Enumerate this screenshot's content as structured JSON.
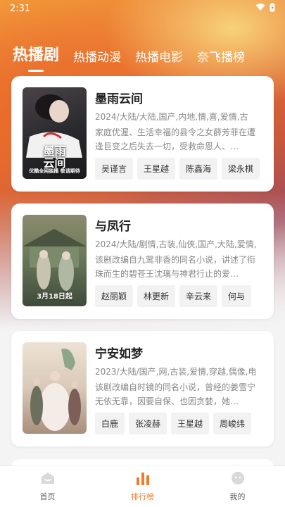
{
  "status": {
    "time": "2:31"
  },
  "tabs": [
    {
      "label": "热播剧",
      "active": true
    },
    {
      "label": "热播动漫",
      "active": false
    },
    {
      "label": "热播电影",
      "active": false
    },
    {
      "label": "奈飞播榜",
      "active": false
    }
  ],
  "items": [
    {
      "title": "墨雨云间",
      "meta": "2024/大陆/大陆,国产,内地,情,喜,爱情,古",
      "desc": "家庭优渥、生活幸福的县令之女薛芳菲在遭逢巨变之后失去一切，受救命恩人、…",
      "actors": [
        "吴谨言",
        "王星越",
        "陈鑫海",
        "梁永棋"
      ],
      "poster_title": "墨雨\n云间",
      "poster_caption": "优酷全网独播 敬请期待",
      "poster_colors": [
        "#2b2b2e",
        "#5a5257"
      ]
    },
    {
      "title": "与凤行",
      "meta": "2024/大陆/剧情,古装,仙侠,国产,大陆,爱情,",
      "desc": "该剧改编自九鹭非香的同名小说，讲述了衔珠而生的碧苍王沈璃与神君行止的爱…",
      "actors": [
        "赵丽颖",
        "林更新",
        "辛云来",
        "何与"
      ],
      "poster_caption": "3月18日起",
      "poster_colors": [
        "#6b7a5a",
        "#a39a78"
      ]
    },
    {
      "title": "宁安如梦",
      "meta": "2023/大陆/国产,网,古装,爱情,穿越,偶像,电",
      "desc": "该剧改编自时镜的同名小说，曾经的姜雪宁无依无靠，因要自保、也因贪婪，她…",
      "actors": [
        "白鹿",
        "张凌赫",
        "王星越",
        "周峻纬"
      ],
      "poster_colors": [
        "#d9c9b8",
        "#b7a08f"
      ]
    }
  ],
  "nav": [
    {
      "label": "首页",
      "icon": "home-icon"
    },
    {
      "label": "排行榜",
      "icon": "chart-icon"
    },
    {
      "label": "我的",
      "icon": "profile-icon"
    }
  ],
  "colors": {
    "accent": "#f07c2a"
  }
}
